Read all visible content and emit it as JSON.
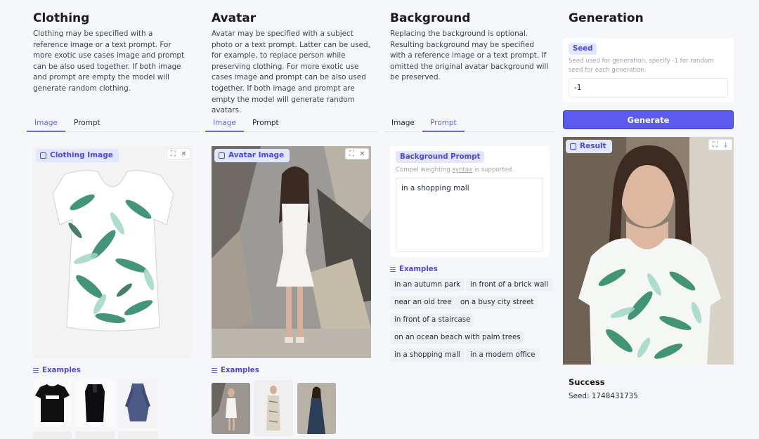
{
  "clothing": {
    "title": "Clothing",
    "description": "Clothing may be specified with a reference image or a text prompt. For more exotic use cases image and prompt can be also used together. If both image and prompt are empty the model will generate random clothing.",
    "tabs": [
      "Image",
      "Prompt"
    ],
    "active_tab": "Image",
    "image_label": "Clothing Image",
    "examples_label": "Examples"
  },
  "avatar": {
    "title": "Avatar",
    "description": "Avatar may be specified with a subject photo or a text prompt. Latter can be used, for example, to replace person while preserving clothing. For more exotic use cases image and prompt can be also used together. If both image and prompt are empty the model will generate random avatars.",
    "tabs": [
      "Image",
      "Prompt"
    ],
    "active_tab": "Image",
    "image_label": "Avatar Image",
    "examples_label": "Examples"
  },
  "background": {
    "title": "Background",
    "description": "Replacing the background is optional. Resulting background may be specified with a reference image or a text prompt. If omitted the original avatar background will be preserved.",
    "tabs": [
      "Image",
      "Prompt"
    ],
    "active_tab": "Prompt",
    "prompt_label": "Background Prompt",
    "prompt_hint_pre": "Compel weighting ",
    "prompt_hint_link": "syntax",
    "prompt_hint_post": " is supported.",
    "prompt_value": "in a shopping mall",
    "examples_label": "Examples",
    "examples": [
      "in an autumn park",
      "in front of a brick wall",
      "near an old tree",
      "on a busy city street",
      "in front of a staircase",
      "on an ocean beach with palm trees",
      "in a shopping mall",
      "in a modern office"
    ]
  },
  "generation": {
    "title": "Generation",
    "seed_label": "Seed",
    "seed_hint": "Seed used for generation, specify -1 for random seed for each generation.",
    "seed_value": "-1",
    "generate_label": "Generate",
    "result_label": "Result",
    "status": "Success",
    "seed_result": "Seed: 1748431735"
  },
  "colors": {
    "accent": "#6366f1",
    "button": "#5b5bef",
    "label_bg": "#e0e7ff",
    "page_bg": "#f6f7fb"
  },
  "icons": [
    "image-icon",
    "fullscreen-icon",
    "close-icon",
    "download-icon",
    "list-icon"
  ]
}
